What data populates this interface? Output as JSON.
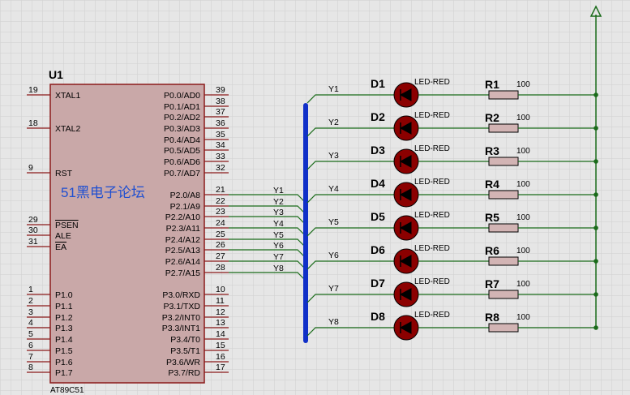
{
  "chip": {
    "ref": "U1",
    "part": "AT89C51",
    "left_pins": [
      {
        "num": "19",
        "name": "XTAL1"
      },
      {
        "num": "18",
        "name": "XTAL2"
      },
      {
        "num": "9",
        "name": "RST"
      },
      {
        "num": "29",
        "name": "PSEN"
      },
      {
        "num": "30",
        "name": "ALE"
      },
      {
        "num": "31",
        "name": "EA"
      },
      {
        "num": "1",
        "name": "P1.0"
      },
      {
        "num": "2",
        "name": "P1.1"
      },
      {
        "num": "3",
        "name": "P1.2"
      },
      {
        "num": "4",
        "name": "P1.3"
      },
      {
        "num": "5",
        "name": "P1.4"
      },
      {
        "num": "6",
        "name": "P1.5"
      },
      {
        "num": "7",
        "name": "P1.6"
      },
      {
        "num": "8",
        "name": "P1.7"
      }
    ],
    "right_pins": [
      {
        "num": "39",
        "name": "P0.0/AD0"
      },
      {
        "num": "38",
        "name": "P0.1/AD1"
      },
      {
        "num": "37",
        "name": "P0.2/AD2"
      },
      {
        "num": "36",
        "name": "P0.3/AD3"
      },
      {
        "num": "35",
        "name": "P0.4/AD4"
      },
      {
        "num": "34",
        "name": "P0.5/AD5"
      },
      {
        "num": "33",
        "name": "P0.6/AD6"
      },
      {
        "num": "32",
        "name": "P0.7/AD7"
      },
      {
        "num": "21",
        "name": "P2.0/A8"
      },
      {
        "num": "22",
        "name": "P2.1/A9"
      },
      {
        "num": "23",
        "name": "P2.2/A10"
      },
      {
        "num": "24",
        "name": "P2.3/A11"
      },
      {
        "num": "25",
        "name": "P2.4/A12"
      },
      {
        "num": "26",
        "name": "P2.5/A13"
      },
      {
        "num": "27",
        "name": "P2.6/A14"
      },
      {
        "num": "28",
        "name": "P2.7/A15"
      },
      {
        "num": "10",
        "name": "P3.0/RXD"
      },
      {
        "num": "11",
        "name": "P3.1/TXD"
      },
      {
        "num": "12",
        "name": "P3.2/INT0"
      },
      {
        "num": "13",
        "name": "P3.3/INT1"
      },
      {
        "num": "14",
        "name": "P3.4/T0"
      },
      {
        "num": "15",
        "name": "P3.5/T1"
      },
      {
        "num": "16",
        "name": "P3.6/WR"
      },
      {
        "num": "17",
        "name": "P3.7/RD"
      }
    ]
  },
  "bus_nets": [
    "Y1",
    "Y2",
    "Y3",
    "Y4",
    "Y5",
    "Y6",
    "Y7",
    "Y8"
  ],
  "leds": [
    {
      "ref": "D1",
      "value": "LED-RED"
    },
    {
      "ref": "D2",
      "value": "LED-RED"
    },
    {
      "ref": "D3",
      "value": "LED-RED"
    },
    {
      "ref": "D4",
      "value": "LED-RED"
    },
    {
      "ref": "D5",
      "value": "LED-RED"
    },
    {
      "ref": "D6",
      "value": "LED-RED"
    },
    {
      "ref": "D7",
      "value": "LED-RED"
    },
    {
      "ref": "D8",
      "value": "LED-RED"
    }
  ],
  "resistors": [
    {
      "ref": "R1",
      "value": "100"
    },
    {
      "ref": "R2",
      "value": "100"
    },
    {
      "ref": "R3",
      "value": "100"
    },
    {
      "ref": "R4",
      "value": "100"
    },
    {
      "ref": "R5",
      "value": "100"
    },
    {
      "ref": "R6",
      "value": "100"
    },
    {
      "ref": "R7",
      "value": "100"
    },
    {
      "ref": "R8",
      "value": "100"
    }
  ],
  "watermark": "51黑电子论坛",
  "colors": {
    "background": "#e6e6e6",
    "grid": "#cfcfcf",
    "wire": "#1a6b1a",
    "bus": "#1030c8",
    "chip_fill": "#c9a8a8",
    "chip_stroke": "#8b1a1a",
    "led_body": "#8b0000",
    "resistor_fill": "#d2b4b4",
    "junction": "#1a6b1a",
    "watermark": "#1f4fd1"
  }
}
